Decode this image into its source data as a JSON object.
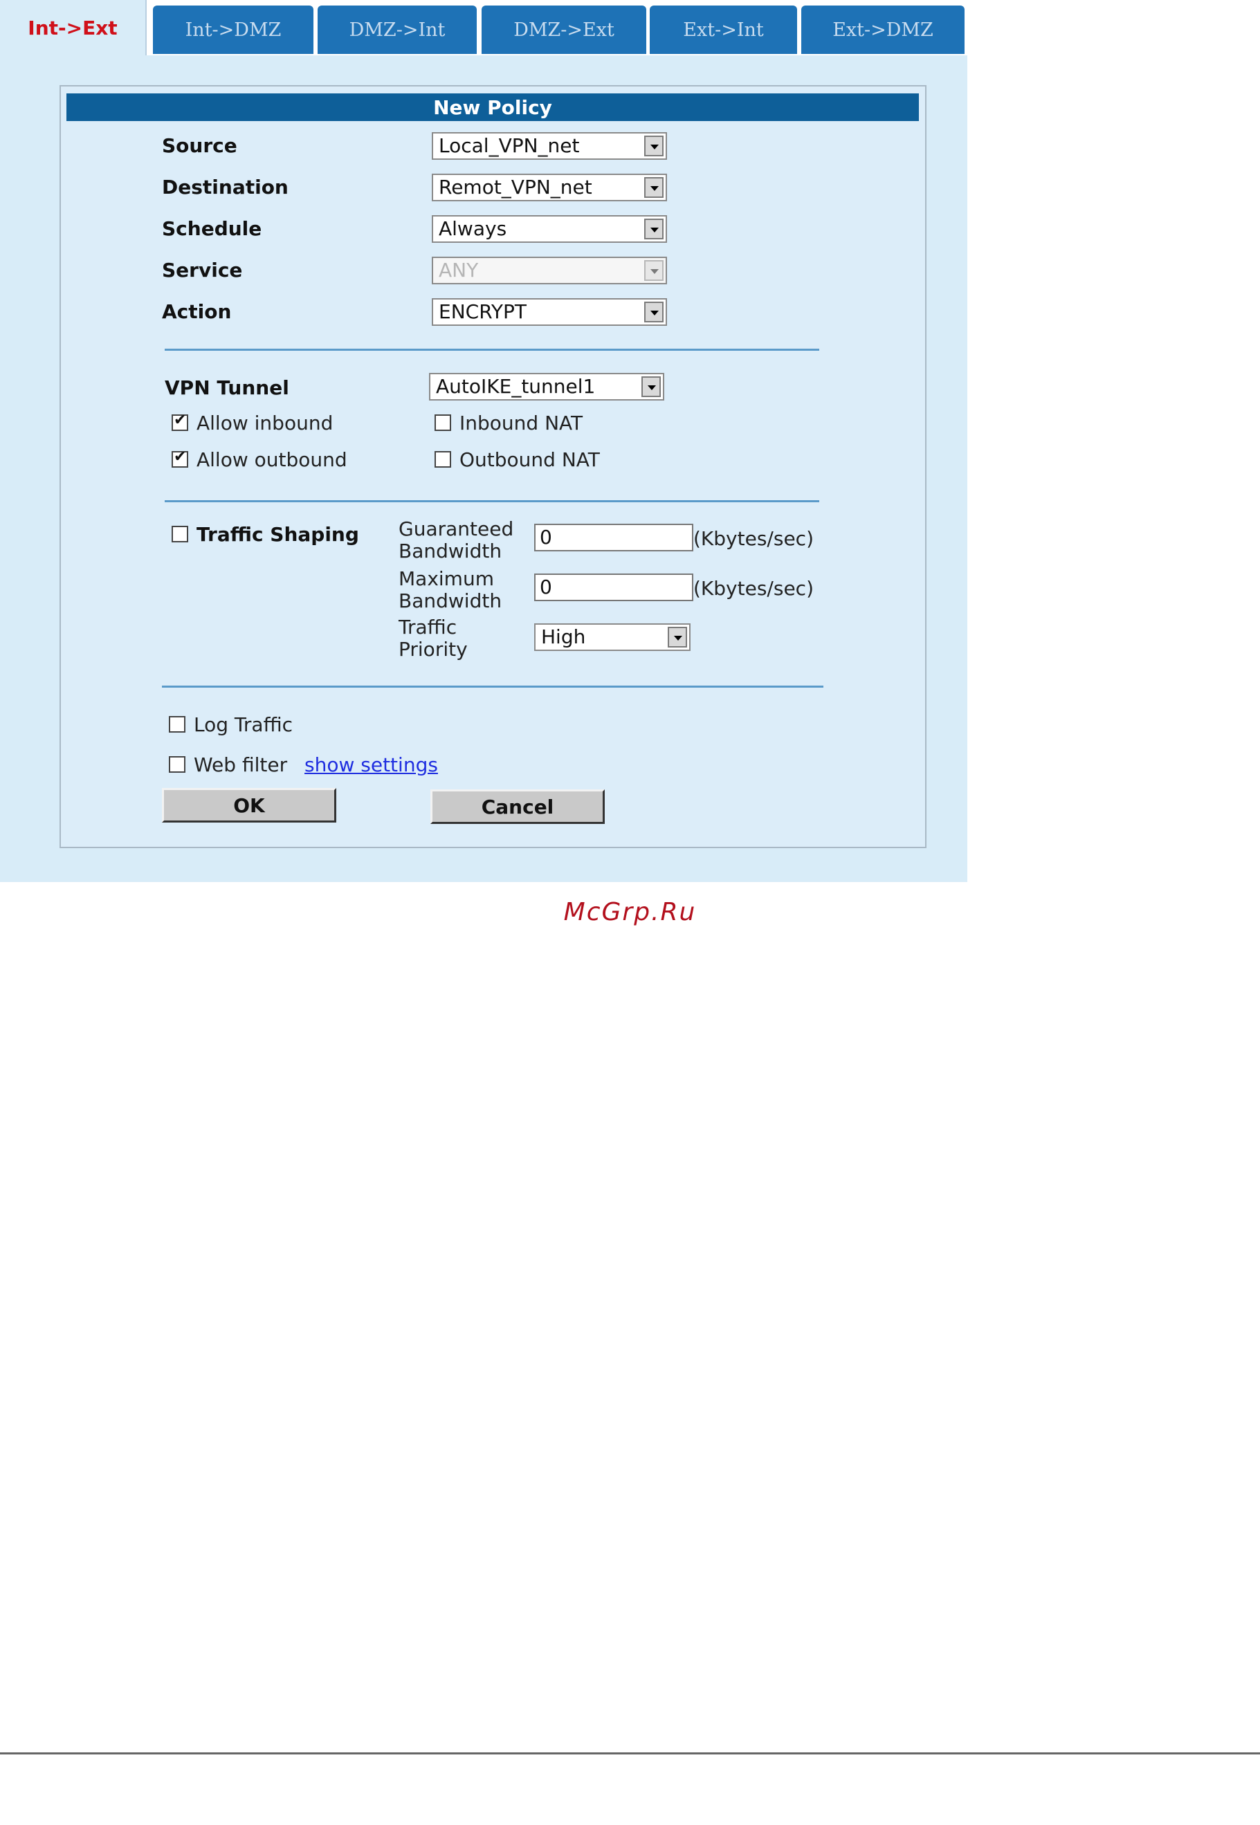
{
  "tabs": [
    {
      "label": "Int->Ext",
      "active": true
    },
    {
      "label": "Int->DMZ",
      "active": false
    },
    {
      "label": "DMZ->Int",
      "active": false
    },
    {
      "label": "DMZ->Ext",
      "active": false
    },
    {
      "label": "Ext->Int",
      "active": false
    },
    {
      "label": "Ext->DMZ",
      "active": false
    }
  ],
  "policy": {
    "title": "New Policy",
    "source": {
      "label": "Source",
      "value": "Local_VPN_net"
    },
    "destination": {
      "label": "Destination",
      "value": "Remot_VPN_net"
    },
    "schedule": {
      "label": "Schedule",
      "value": "Always"
    },
    "service": {
      "label": "Service",
      "value": "ANY",
      "disabled": true
    },
    "action": {
      "label": "Action",
      "value": "ENCRYPT"
    }
  },
  "vpn": {
    "label": "VPN Tunnel",
    "value": "AutoIKE_tunnel1",
    "allow_inbound": {
      "label": "Allow inbound",
      "checked": true
    },
    "allow_outbound": {
      "label": "Allow outbound",
      "checked": true
    },
    "inbound_nat": {
      "label": "Inbound NAT",
      "checked": false
    },
    "outbound_nat": {
      "label": "Outbound NAT",
      "checked": false
    }
  },
  "traffic_shaping": {
    "label": "Traffic Shaping",
    "checked": false,
    "guaranteed_label_1": "Guaranteed",
    "guaranteed_label_2": "Bandwidth",
    "guaranteed_value": "0",
    "maximum_label_1": "Maximum",
    "maximum_label_2": "Bandwidth",
    "maximum_value": "0",
    "unit": "(Kbytes/sec)",
    "priority_label_1": "Traffic",
    "priority_label_2": "Priority",
    "priority_value": "High"
  },
  "log_traffic": {
    "label": "Log Traffic",
    "checked": false
  },
  "web_filter": {
    "label": "Web filter",
    "checked": false,
    "link": "show settings"
  },
  "buttons": {
    "ok": "OK",
    "cancel": "Cancel"
  },
  "watermark": "McGrp.Ru",
  "colors": {
    "tab_blue": "#1e72b6",
    "active_tab_text": "#d0101a",
    "title_bar": "#0e5f99",
    "panel_bg": "#d8ecf8"
  }
}
